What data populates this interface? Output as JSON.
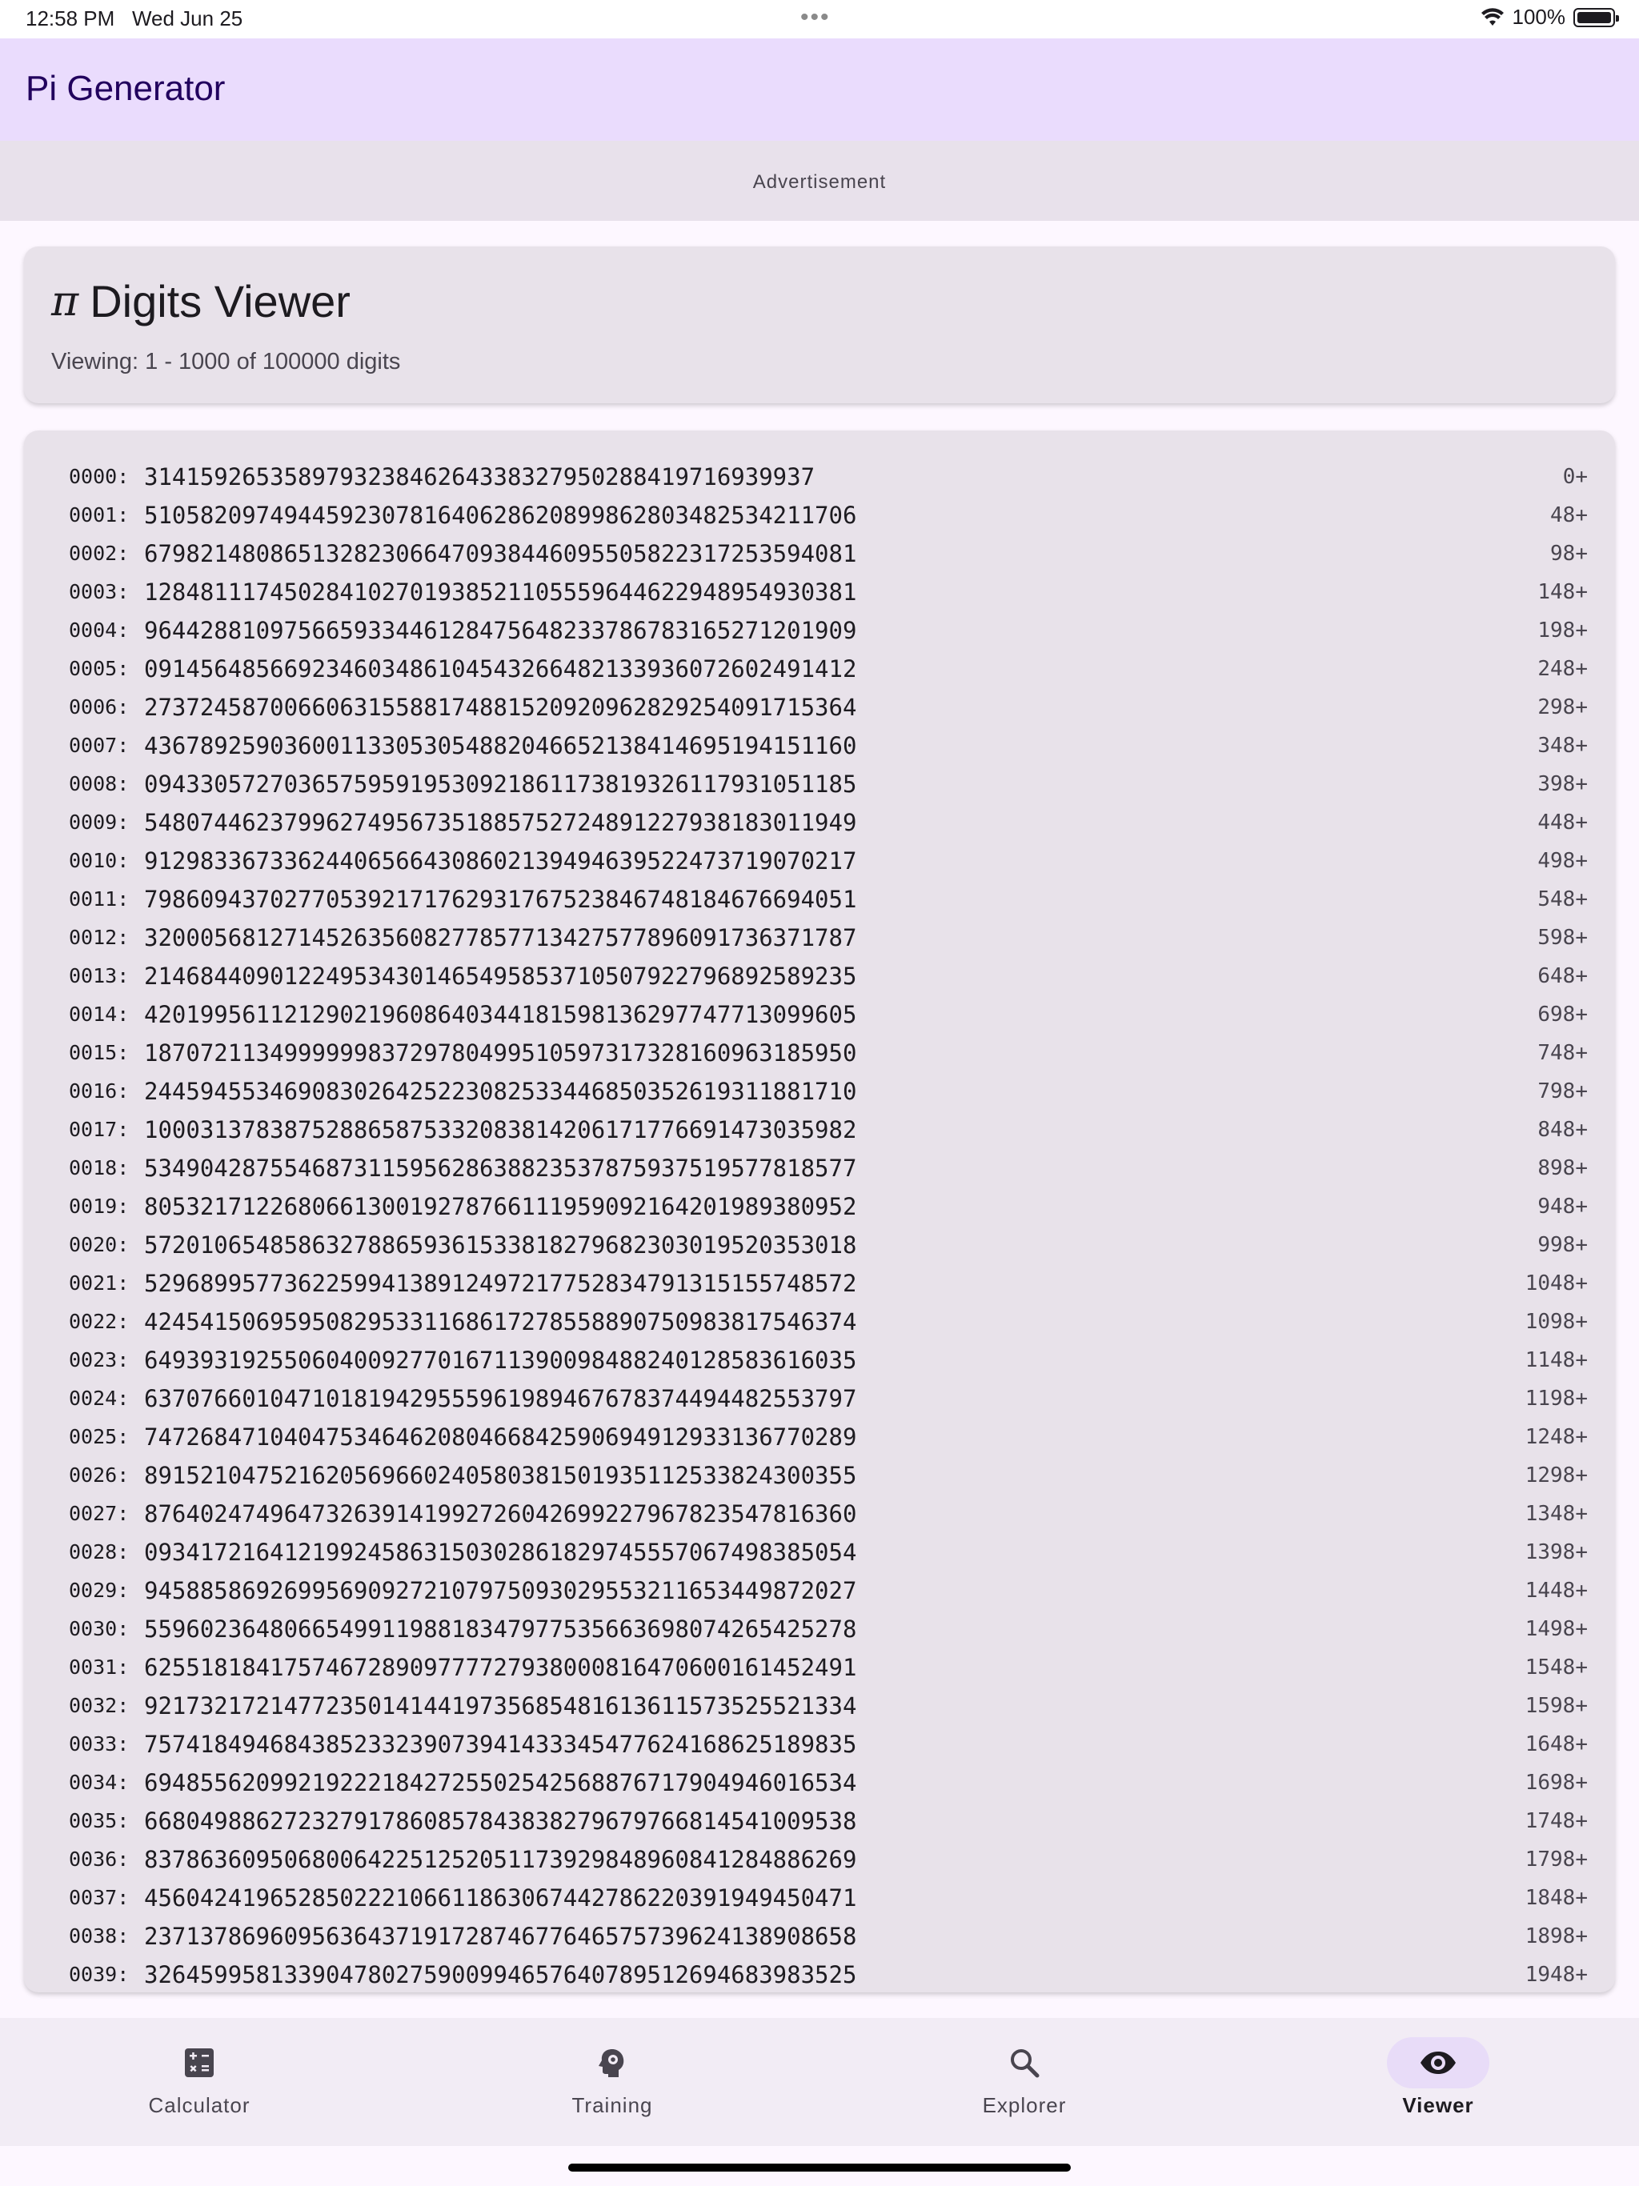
{
  "status_bar": {
    "time": "12:58 PM",
    "date": "Wed Jun 25",
    "dots": "•••",
    "battery": "100%"
  },
  "app_bar": {
    "title": "Pi Generator"
  },
  "ad": {
    "label": "Advertisement"
  },
  "header": {
    "pi_symbol": "π",
    "title": "Digits Viewer",
    "subtitle": "Viewing: 1 - 1000 of 100000 digits"
  },
  "digits": {
    "rows": [
      {
        "index": "0000:",
        "digits": "314159265358979323846264338327950288419716939937",
        "offset": "0+"
      },
      {
        "index": "0001:",
        "digits": "510582097494459230781640628620899862803482534211706",
        "offset": "48+"
      },
      {
        "index": "0002:",
        "digits": "679821480865132823066470938446095505822317253594081",
        "offset": "98+"
      },
      {
        "index": "0003:",
        "digits": "128481117450284102701938521105559644622948954930381",
        "offset": "148+"
      },
      {
        "index": "0004:",
        "digits": "964428810975665933446128475648233786783165271201909",
        "offset": "198+"
      },
      {
        "index": "0005:",
        "digits": "091456485669234603486104543266482133936072602491412",
        "offset": "248+"
      },
      {
        "index": "0006:",
        "digits": "273724587006606315588174881520920962829254091715364",
        "offset": "298+"
      },
      {
        "index": "0007:",
        "digits": "436789259036001133053054882046652138414695194151160",
        "offset": "348+"
      },
      {
        "index": "0008:",
        "digits": "094330572703657595919530921861173819326117931051185",
        "offset": "398+"
      },
      {
        "index": "0009:",
        "digits": "548074462379962749567351885752724891227938183011949",
        "offset": "448+"
      },
      {
        "index": "0010:",
        "digits": "912983367336244065664308602139494639522473719070217",
        "offset": "498+"
      },
      {
        "index": "0011:",
        "digits": "798609437027705392171762931767523846748184676694051",
        "offset": "548+"
      },
      {
        "index": "0012:",
        "digits": "320005681271452635608277857713427577896091736371787",
        "offset": "598+"
      },
      {
        "index": "0013:",
        "digits": "214684409012249534301465495853710507922796892589235",
        "offset": "648+"
      },
      {
        "index": "0014:",
        "digits": "420199561121290219608640344181598136297747713099605",
        "offset": "698+"
      },
      {
        "index": "0015:",
        "digits": "187072113499999983729780499510597317328160963185950",
        "offset": "748+"
      },
      {
        "index": "0016:",
        "digits": "244594553469083026425223082533446850352619311881710",
        "offset": "798+"
      },
      {
        "index": "0017:",
        "digits": "100031378387528865875332083814206171776691473035982",
        "offset": "848+"
      },
      {
        "index": "0018:",
        "digits": "534904287554687311595628638823537875937519577818577",
        "offset": "898+"
      },
      {
        "index": "0019:",
        "digits": "805321712268066130019278766111959092164201989380952",
        "offset": "948+"
      },
      {
        "index": "0020:",
        "digits": "572010654858632788659361533818279682303019520353018",
        "offset": "998+"
      },
      {
        "index": "0021:",
        "digits": "529689957736225994138912497217752834791315155748572",
        "offset": "1048+"
      },
      {
        "index": "0022:",
        "digits": "424541506959508295331168617278558890750983817546374",
        "offset": "1098+"
      },
      {
        "index": "0023:",
        "digits": "649393192550604009277016711390098488240128583616035",
        "offset": "1148+"
      },
      {
        "index": "0024:",
        "digits": "637076601047101819429555961989467678374494482553797",
        "offset": "1198+"
      },
      {
        "index": "0025:",
        "digits": "747268471040475346462080466842590694912933136770289",
        "offset": "1248+"
      },
      {
        "index": "0026:",
        "digits": "891521047521620569660240580381501935112533824300355",
        "offset": "1298+"
      },
      {
        "index": "0027:",
        "digits": "876402474964732639141992726042699227967823547816360",
        "offset": "1348+"
      },
      {
        "index": "0028:",
        "digits": "093417216412199245863150302861829745557067498385054",
        "offset": "1398+"
      },
      {
        "index": "0029:",
        "digits": "945885869269956909272107975093029553211653449872027",
        "offset": "1448+"
      },
      {
        "index": "0030:",
        "digits": "559602364806654991198818347977535663698074265425278",
        "offset": "1498+"
      },
      {
        "index": "0031:",
        "digits": "625518184175746728909777727938000816470600161452491",
        "offset": "1548+"
      },
      {
        "index": "0032:",
        "digits": "921732172147723501414419735685481613611573525521334",
        "offset": "1598+"
      },
      {
        "index": "0033:",
        "digits": "757418494684385233239073941433345477624168625189835",
        "offset": "1648+"
      },
      {
        "index": "0034:",
        "digits": "694855620992192221842725502542568876717904946016534",
        "offset": "1698+"
      },
      {
        "index": "0035:",
        "digits": "668049886272327917860857843838279679766814541009538",
        "offset": "1748+"
      },
      {
        "index": "0036:",
        "digits": "837863609506800642251252051173929848960841284886269",
        "offset": "1798+"
      },
      {
        "index": "0037:",
        "digits": "456042419652850222106611863067442786220391949450471",
        "offset": "1848+"
      },
      {
        "index": "0038:",
        "digits": "237137869609563643719172874677646575739624138908658",
        "offset": "1898+"
      },
      {
        "index": "0039:",
        "digits": "326459958133904780275900994657640789512694683983525",
        "offset": "1948+"
      }
    ]
  },
  "nav": {
    "items": [
      {
        "label": "Calculator",
        "icon": "calculator-icon"
      },
      {
        "label": "Training",
        "icon": "brain-icon"
      },
      {
        "label": "Explorer",
        "icon": "search-icon"
      },
      {
        "label": "Viewer",
        "icon": "eye-icon"
      }
    ],
    "active": "Viewer"
  }
}
